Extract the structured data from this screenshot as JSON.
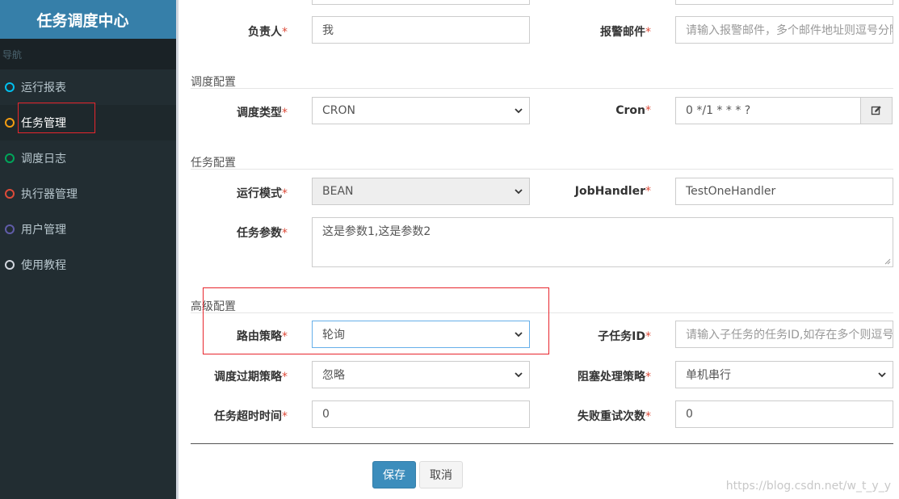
{
  "sidebar": {
    "brand": "任务调度中心",
    "nav_header": "导航",
    "items": [
      {
        "label": "运行报表",
        "icon": "circle-icon-aqua"
      },
      {
        "label": "任务管理",
        "icon": "circle-icon-orange"
      },
      {
        "label": "调度日志",
        "icon": "circle-icon-green"
      },
      {
        "label": "执行器管理",
        "icon": "circle-icon-red"
      },
      {
        "label": "用户管理",
        "icon": "circle-icon-purple"
      },
      {
        "label": "使用教程",
        "icon": "circle-icon-gray"
      }
    ],
    "active_item": "任务管理"
  },
  "form": {
    "owner": {
      "label": "负责人",
      "value": "我"
    },
    "alarm_email": {
      "label": "报警邮件",
      "placeholder": "请输入报警邮件，多个邮件地址则逗号分隔"
    },
    "schedule_section": "调度配置",
    "schedule_type": {
      "label": "调度类型",
      "value": "CRON"
    },
    "cron": {
      "label": "Cron",
      "value": "0 */1 * * * ?"
    },
    "task_section": "任务配置",
    "run_mode": {
      "label": "运行模式",
      "value": "BEAN"
    },
    "job_handler": {
      "label": "JobHandler",
      "value": "TestOneHandler"
    },
    "task_params": {
      "label": "任务参数",
      "value": "这是参数1,这是参数2"
    },
    "advanced_section": "高级配置",
    "route_strategy": {
      "label": "路由策略",
      "value": "轮询"
    },
    "child_job_id": {
      "label": "子任务ID",
      "placeholder": "请输入子任务的任务ID,如存在多个则逗号分隔"
    },
    "misfire_strategy": {
      "label": "调度过期策略",
      "value": "忽略"
    },
    "block_strategy": {
      "label": "阻塞处理策略",
      "value": "单机串行"
    },
    "timeout": {
      "label": "任务超时时间",
      "value": "0"
    },
    "fail_retry": {
      "label": "失败重试次数",
      "value": "0"
    },
    "required_mark": "*",
    "save_label": "保存",
    "cancel_label": "取消"
  },
  "watermark": "https://blog.csdn.net/w_t_y_y",
  "colors": {
    "accent": "#3c8dbc",
    "sidebar_bg": "#222d32",
    "brand_bg": "#367fa9",
    "required": "#dd4b39",
    "annotation": "#e8262d"
  }
}
